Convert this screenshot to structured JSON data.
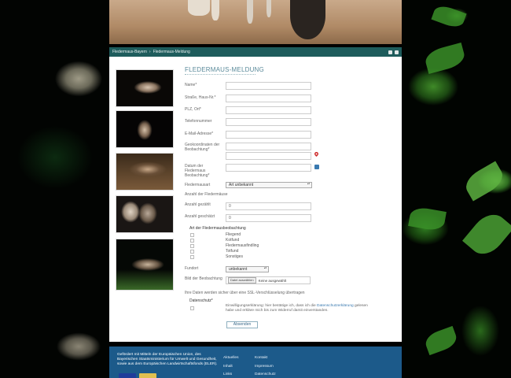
{
  "breadcrumb": {
    "home": "Fledermaus-Bayern",
    "current": "Fledermaus-Meldung"
  },
  "form": {
    "title": "FLEDERMAUS-MELDUNG",
    "fields": {
      "name": "Name*",
      "street": "Straße, Haus-Nr.*",
      "zip_city": "PLZ, Ort*",
      "phone": "Telefonnummer",
      "email": "E-Mail-Adresse*",
      "geo": "Geokoordinaten der Beobachtung*",
      "date": "Datum der Fledermaus Beobachtung*",
      "species": "Fledermausart",
      "count_heading": "Anzahl der Fledermäuse",
      "count_counted": "Anzahl gezählt",
      "count_estimated": "Anzahl geschätzt",
      "location": "Fundort",
      "photo": "Bild der Beobachtung"
    },
    "values": {
      "species": "Art unbekannt",
      "count_counted": "0",
      "count_estimated": "0",
      "location": "unbekannt",
      "file_button": "Datei auswählen",
      "file_status": "Keine ausgewählt"
    },
    "observation_type_heading": "Art der Fledermausbeobachtung",
    "observation_types": [
      "Fliegend",
      "Kotfund",
      "Fledermausfindling",
      "Totfund",
      "Sonstiges"
    ],
    "ssl_note": "Ihre Daten werden sicher über eine SSL-Verschlüsselung übertragen",
    "privacy_heading": "Datenschutz*",
    "consent_before": "Einwilligungserklärung: hier bestätige ich, dass ich die ",
    "consent_link": "Datenschutzerklärung",
    "consent_after": " gelesen habe und erkläre mich bis zum Widerruf damit einverstanden.",
    "submit_label": "Absenden"
  },
  "footer": {
    "funding_text": "Gefördert mit Mitteln der Europäischen Union, des Bayerischen Staatsministerium für Umwelt und Gesundheit, sowie aus dem Europäischen Landwirtschaftsfonds (ELER).",
    "links_col1": [
      "Aktuelles",
      "Inhalt",
      "Links"
    ],
    "links_col2": [
      "Kontakt",
      "Impressum",
      "Datenschutz"
    ]
  },
  "colors": {
    "breadcrumb_bg": "#1e5c5c",
    "footer_bg": "#1c5a8a",
    "title": "#5a8a9a",
    "link": "#3a7ab0"
  }
}
